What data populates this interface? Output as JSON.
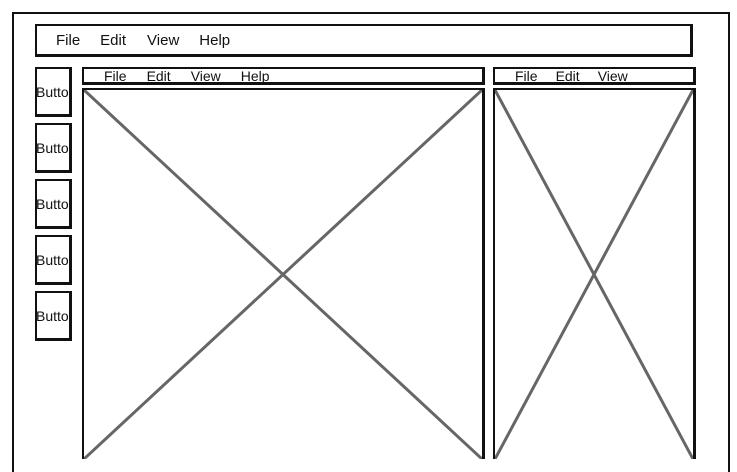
{
  "app_menu": {
    "items": [
      "File",
      "Edit",
      "View",
      "Help"
    ]
  },
  "sidebar": {
    "buttons": [
      "Button",
      "Button",
      "Button",
      "Button",
      "Button"
    ]
  },
  "left_panel": {
    "menu": [
      "File",
      "Edit",
      "View",
      "Help"
    ],
    "content": "image-placeholder-icon"
  },
  "right_panel": {
    "menu": [
      "File",
      "Edit",
      "View"
    ],
    "content": "image-placeholder-icon"
  },
  "colors": {
    "stroke": "#111111",
    "placeholder_x": "#666666",
    "background": "#ffffff"
  }
}
